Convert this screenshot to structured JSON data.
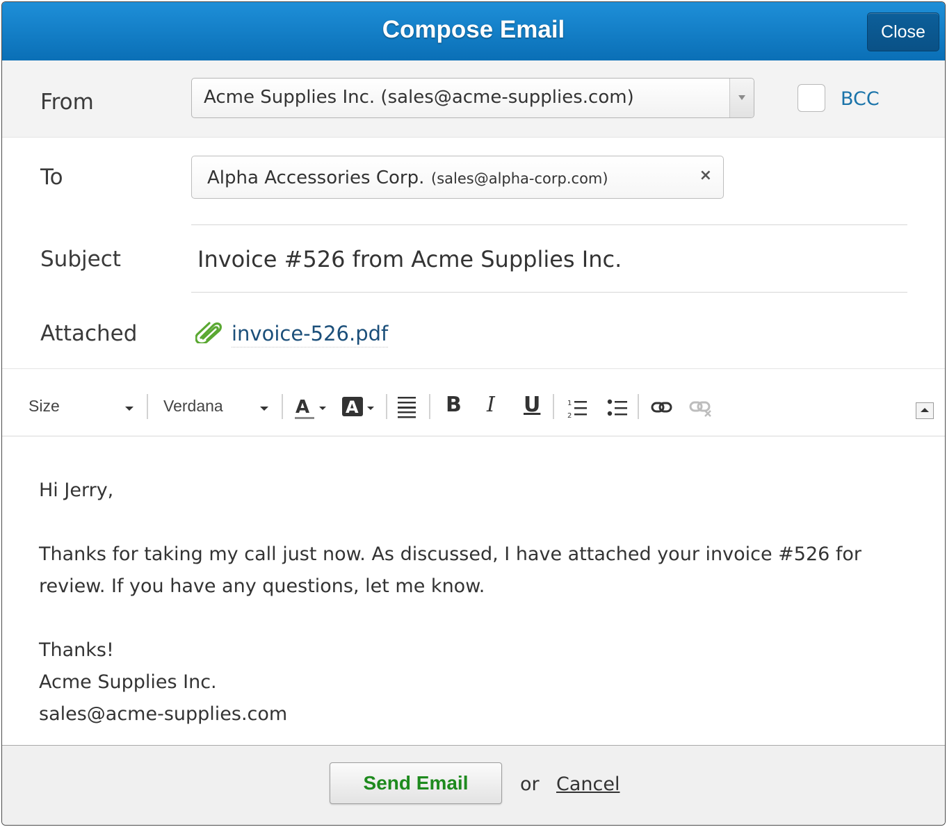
{
  "header": {
    "title": "Compose Email",
    "close_label": "Close"
  },
  "from": {
    "label": "From",
    "selected": "Acme Supplies Inc. (sales@acme-supplies.com)",
    "bcc_label": "BCC",
    "bcc_checked": false
  },
  "to": {
    "label": "To",
    "recipient_name": "Alpha Accessories Corp.",
    "recipient_email": "(sales@alpha-corp.com)",
    "remove_symbol": "×"
  },
  "subject": {
    "label": "Subject",
    "value": "Invoice #526 from Acme Supplies Inc."
  },
  "attached": {
    "label": "Attached",
    "file": "invoice-526.pdf"
  },
  "toolbar": {
    "size_label": "Size",
    "font_label": "Verdana",
    "bold": "B",
    "italic": "I",
    "underline": "U"
  },
  "body": {
    "greeting": "Hi Jerry,",
    "line1": "Thanks for taking my call just now. As discussed, I have attached your invoice #526 for",
    "line2": "review. If you have any questions, let me know.",
    "thanks": "Thanks!",
    "sig_name": "Acme Supplies Inc.",
    "sig_email": "sales@acme-supplies.com"
  },
  "footer": {
    "send_label": "Send Email",
    "or_text": "or",
    "cancel_label": "Cancel"
  },
  "colors": {
    "header_blue": "#0a6fb6",
    "link_blue": "#1a73a9",
    "send_green": "#1e8a1e",
    "clip_green": "#5aa832"
  }
}
